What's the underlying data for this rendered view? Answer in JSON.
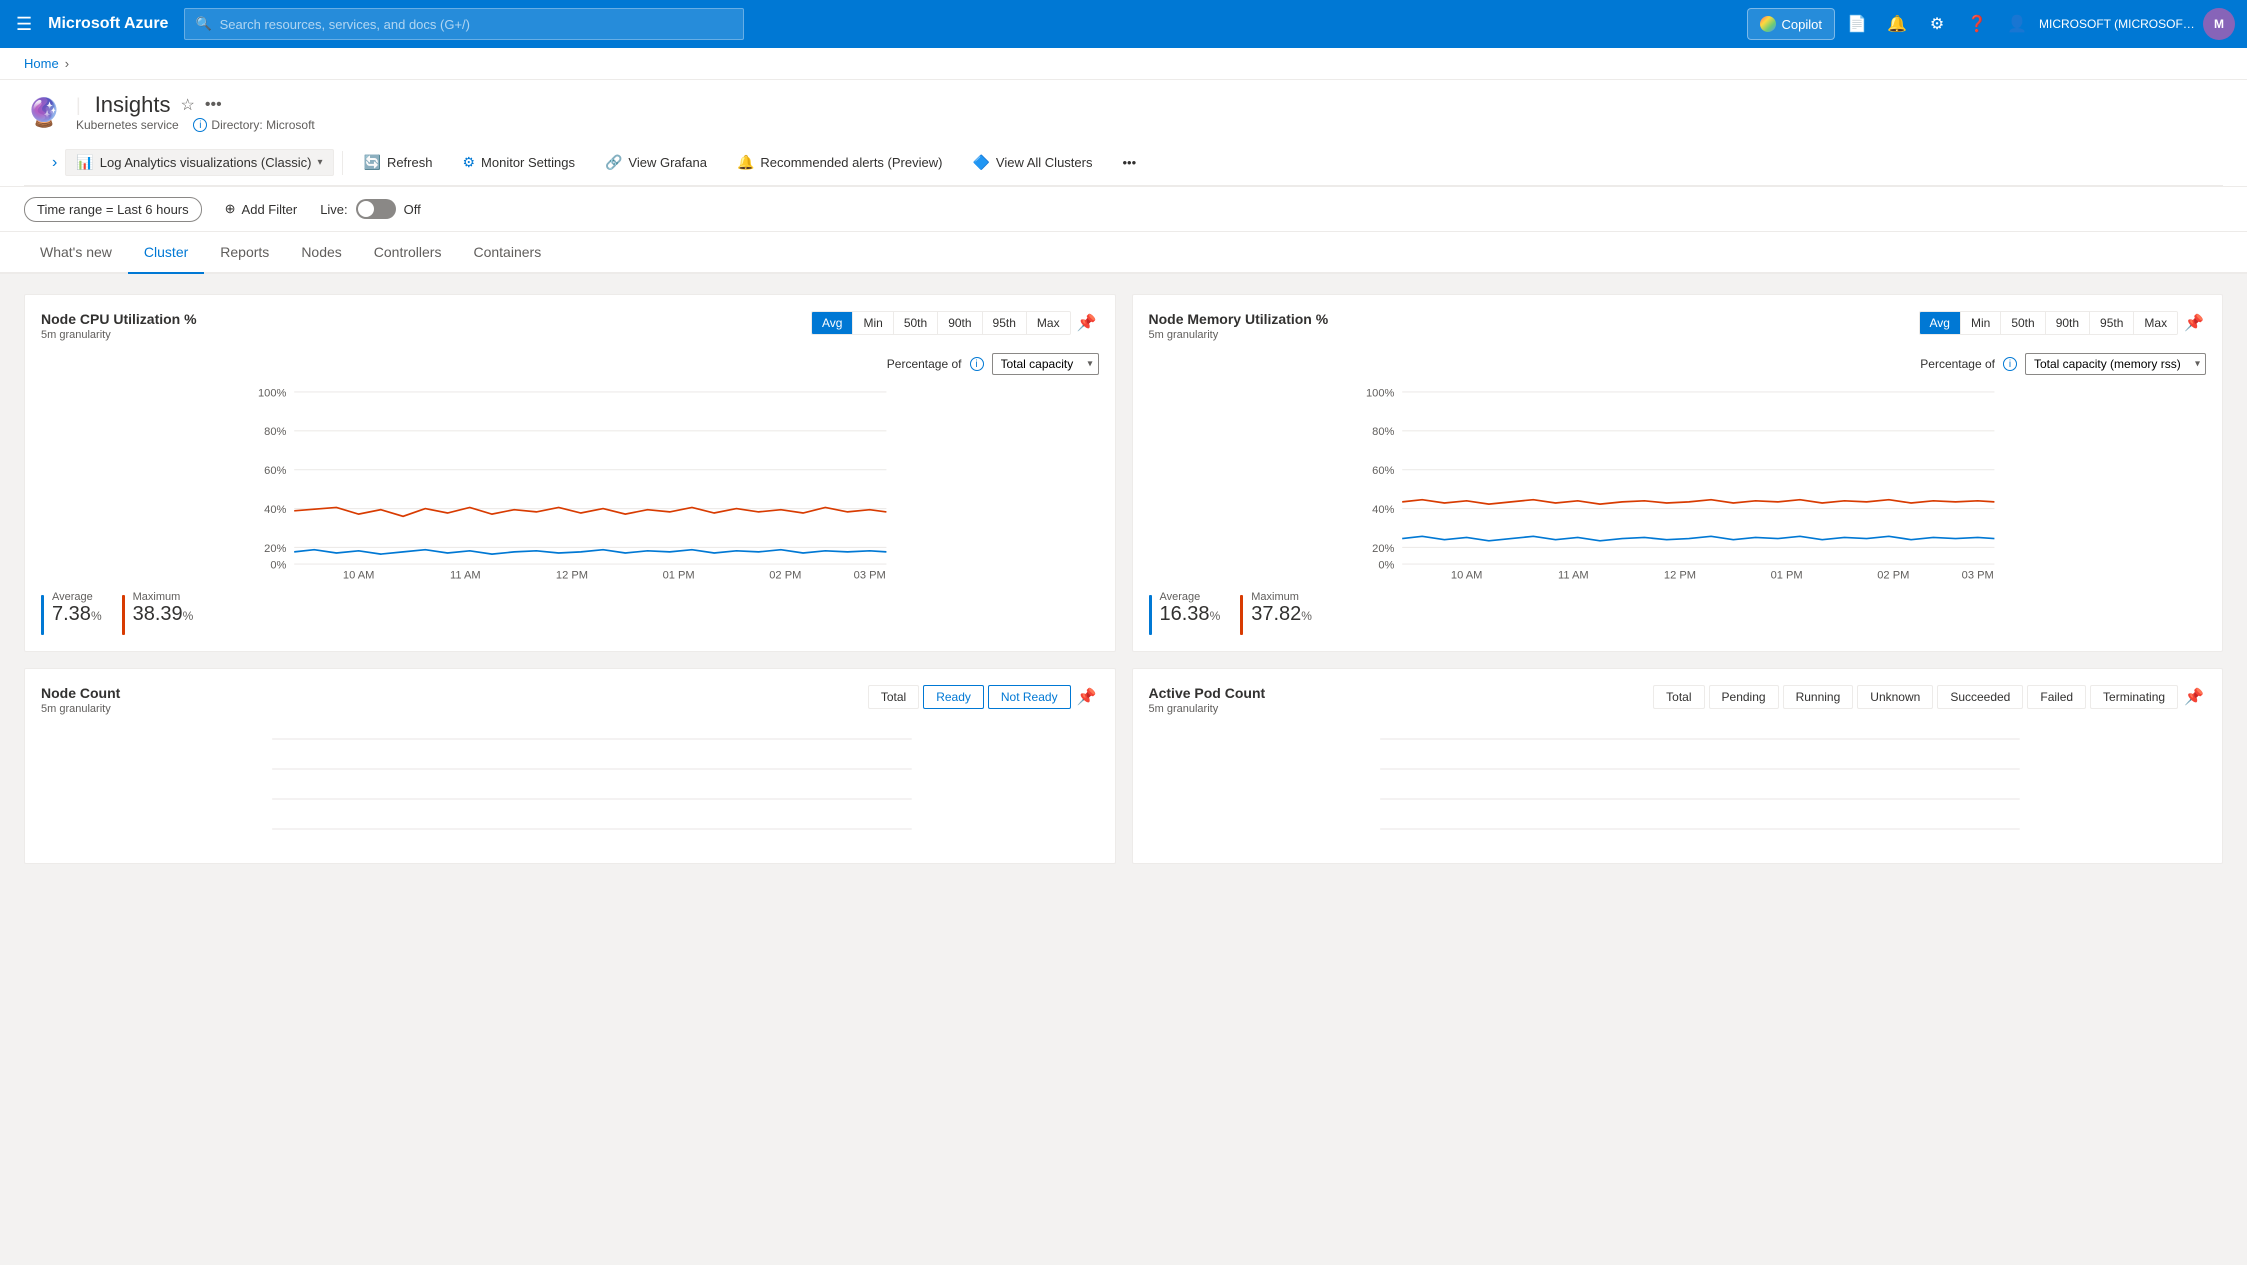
{
  "topbar": {
    "hamburger_label": "☰",
    "logo": "Microsoft Azure",
    "search_placeholder": "Search resources, services, and docs (G+/)",
    "copilot_label": "Copilot",
    "user_label": "MICROSOFT (MICROSOFT.ONMI...",
    "user_initials": "M"
  },
  "breadcrumb": {
    "home_label": "Home",
    "separator": "›"
  },
  "page_header": {
    "service_name": "Kubernetes service",
    "title_prefix": "|",
    "title": "Insights",
    "directory_label": "Directory: Microsoft",
    "close_label": "✕"
  },
  "toolbar": {
    "expand_label": "›",
    "nav_label": "Log Analytics visualizations (Classic)",
    "refresh_label": "Refresh",
    "monitor_settings_label": "Monitor Settings",
    "view_grafana_label": "View Grafana",
    "recommended_alerts_label": "Recommended alerts (Preview)",
    "view_all_clusters_label": "View All Clusters",
    "more_label": "•••"
  },
  "filter_bar": {
    "time_range_label": "Time range = Last 6 hours",
    "add_filter_label": "Add Filter",
    "live_label": "Live:",
    "live_state": "Off",
    "live_active": false
  },
  "tabs": [
    {
      "id": "whats-new",
      "label": "What's new",
      "active": false
    },
    {
      "id": "cluster",
      "label": "Cluster",
      "active": true
    },
    {
      "id": "reports",
      "label": "Reports",
      "active": false
    },
    {
      "id": "nodes",
      "label": "Nodes",
      "active": false
    },
    {
      "id": "controllers",
      "label": "Controllers",
      "active": false
    },
    {
      "id": "containers",
      "label": "Containers",
      "active": false
    }
  ],
  "cpu_chart": {
    "title": "Node CPU Utilization %",
    "granularity": "5m granularity",
    "percentage_label": "Percentage of",
    "dropdown_option": "Total capacity",
    "btn_group": [
      "Avg",
      "Min",
      "50th",
      "90th",
      "95th",
      "Max"
    ],
    "active_btn": "Avg",
    "average_label": "Average",
    "average_value": "7.38",
    "average_unit": "%",
    "maximum_label": "Maximum",
    "maximum_value": "38.39",
    "maximum_unit": "%",
    "avg_color": "#0078d4",
    "max_color": "#d83b01",
    "x_labels": [
      "10 AM",
      "11 AM",
      "12 PM",
      "01 PM",
      "02 PM",
      "03 PM"
    ],
    "y_labels": [
      "100%",
      "80%",
      "60%",
      "40%",
      "20%",
      "0%"
    ]
  },
  "memory_chart": {
    "title": "Node Memory Utilization %",
    "granularity": "5m granularity",
    "percentage_label": "Percentage of",
    "dropdown_option": "Total capacity (memory rss)",
    "btn_group": [
      "Avg",
      "Min",
      "50th",
      "90th",
      "95th",
      "Max"
    ],
    "active_btn": "Avg",
    "average_label": "Average",
    "average_value": "16.38",
    "average_unit": "%",
    "maximum_label": "Maximum",
    "maximum_value": "37.82",
    "maximum_unit": "%",
    "avg_color": "#0078d4",
    "max_color": "#d83b01",
    "x_labels": [
      "10 AM",
      "11 AM",
      "12 PM",
      "01 PM",
      "02 PM",
      "03 PM"
    ],
    "y_labels": [
      "100%",
      "80%",
      "60%",
      "40%",
      "20%",
      "0%"
    ]
  },
  "node_count_chart": {
    "title": "Node Count",
    "granularity": "5m granularity",
    "buttons": [
      "Total",
      "Ready",
      "Not Ready"
    ],
    "active_btns": [
      "Ready",
      "Not Ready"
    ]
  },
  "active_pod_chart": {
    "title": "Active Pod Count",
    "granularity": "5m granularity",
    "buttons": [
      "Total",
      "Pending",
      "Running",
      "Unknown",
      "Succeeded",
      "Failed",
      "Terminating"
    ]
  }
}
